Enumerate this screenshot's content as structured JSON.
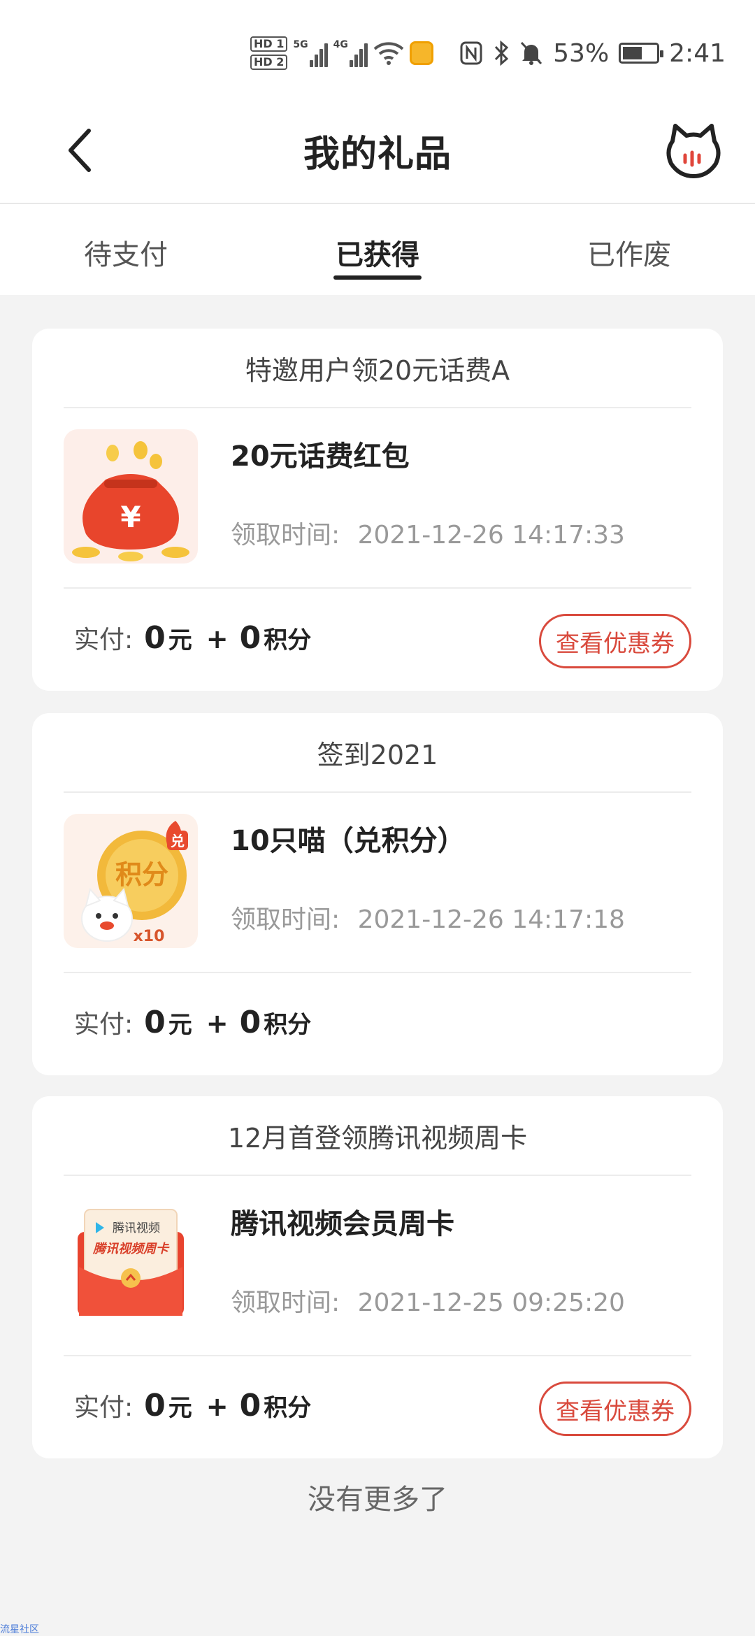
{
  "status_bar": {
    "hd1": "HD 1",
    "hd2": "HD 2",
    "sim1_type": "5G",
    "sim2_type": "4G",
    "battery_percent": "53%",
    "time": "2:41",
    "icons": [
      "wifi-icon",
      "app-notification-icon",
      "nfc-icon",
      "bluetooth-icon",
      "mute-bell-icon",
      "battery-charging-icon"
    ]
  },
  "header": {
    "title": "我的礼品",
    "back_icon": "chevron-left-icon",
    "mascot_icon": "cat-mascot-icon"
  },
  "tabs": [
    {
      "label": "待支付",
      "active": false
    },
    {
      "label": "已获得",
      "active": true
    },
    {
      "label": "已作废",
      "active": false
    }
  ],
  "cards": [
    {
      "title": "特邀用户领20元话费A",
      "item_name": "20元话费红包",
      "time_label": "领取时间:",
      "time": "2021-12-26 14:17:33",
      "pay_label": "实付:",
      "yuan": "0",
      "yuan_unit": "元",
      "plus": "+",
      "points": "0",
      "points_unit": "积分",
      "button": "查看优惠券",
      "thumb": "red-envelope-money-bag-icon"
    },
    {
      "title": "签到2021",
      "item_name": "10只喵（兑积分）",
      "time_label": "领取时间:",
      "time": "2021-12-26 14:17:18",
      "pay_label": "实付:",
      "yuan": "0",
      "yuan_unit": "元",
      "plus": "+",
      "points": "0",
      "points_unit": "积分",
      "thumb": "points-coin-icon",
      "thumb_text": "积分",
      "thumb_badge": "兑",
      "thumb_multiplier": "x10"
    },
    {
      "title": "12月首登领腾讯视频周卡",
      "item_name": "腾讯视频会员周卡",
      "time_label": "领取时间:",
      "time": "2021-12-25 09:25:20",
      "pay_label": "实付:",
      "yuan": "0",
      "yuan_unit": "元",
      "plus": "+",
      "points": "0",
      "points_unit": "积分",
      "button": "查看优惠券",
      "thumb": "tencent-video-envelope-icon",
      "thumb_brand": "腾讯视频",
      "thumb_caption": "腾讯视频周卡"
    }
  ],
  "footer": {
    "no_more": "没有更多了",
    "watermark": "流星社区"
  },
  "colors": {
    "accent_red": "#d94a3d",
    "page_bg": "#f3f3f3"
  }
}
